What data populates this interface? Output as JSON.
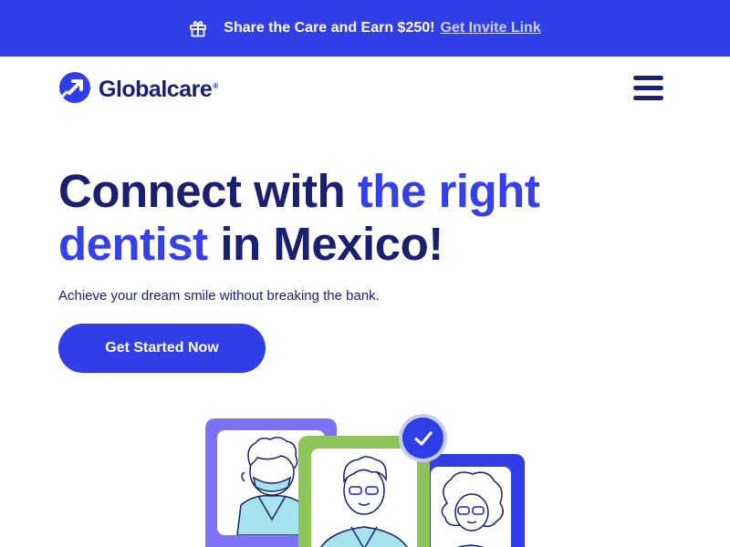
{
  "promo": {
    "text": "Share the Care and Earn $250!",
    "link": "Get Invite Link",
    "icon": "gift-icon"
  },
  "nav": {
    "logo_text": "Globalcare",
    "logo_mark": "®",
    "menu_icon": "hamburger-menu-icon"
  },
  "hero": {
    "title_part1": "Connect with ",
    "title_accent1": "the right",
    "title_accent2": "dentist",
    "title_part2": " in Mexico!",
    "subtitle": "Achieve your dream smile without breaking the bank.",
    "cta_label": "Get Started Now"
  },
  "colors": {
    "brand_blue": "#2f3ee6",
    "navy": "#1a2070",
    "accent_text": "#3640e8",
    "card_purple": "#7b72f5",
    "card_green": "#8dc45a",
    "card_blue": "#2f3ee6"
  }
}
